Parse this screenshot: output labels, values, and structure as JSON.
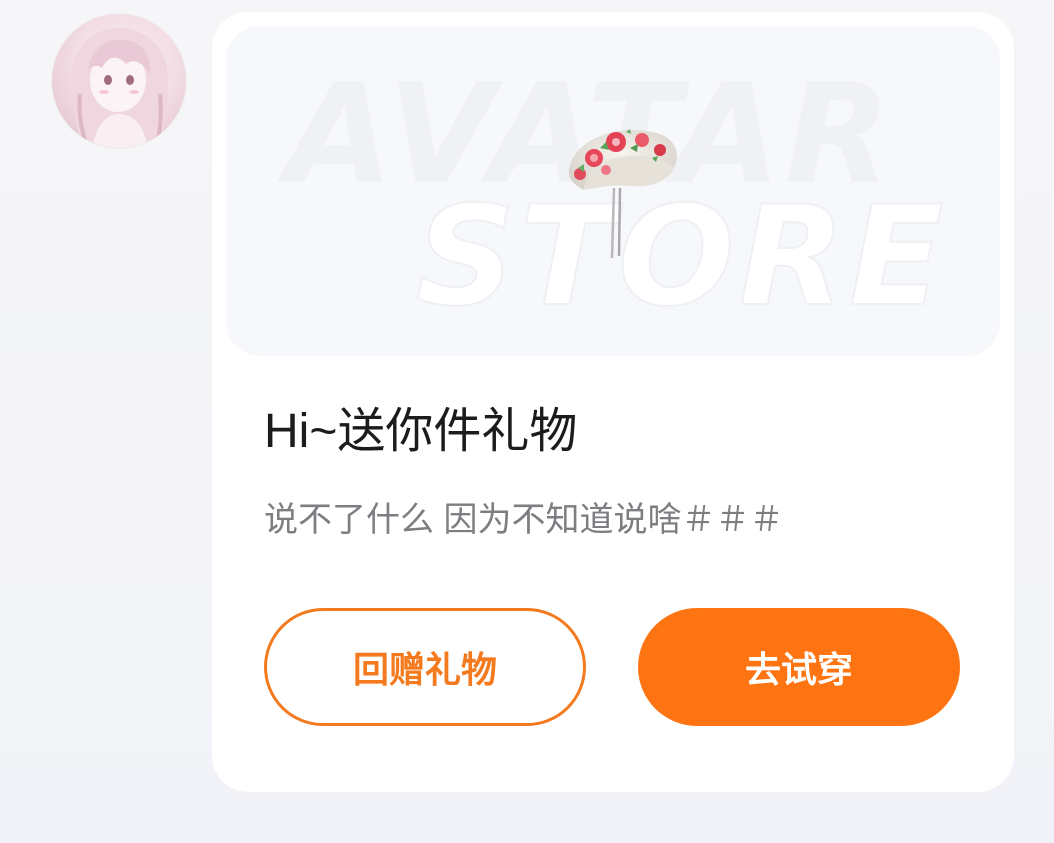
{
  "colors": {
    "accent": "#ff7412",
    "accent_outline": "#f47a1f",
    "title": "#1c1c1e",
    "subtitle": "#7d7d82",
    "card": "#ffffff",
    "page": "#f4f5f9"
  },
  "sender": {
    "avatar_icon": "anime-girl-avatar"
  },
  "gift_card": {
    "banner": {
      "watermark_line1": "AVATAR",
      "watermark_line2": "STORE",
      "product_icon": "floral-hair-clip-icon"
    },
    "title": "Hi~送你件礼物",
    "message": "说不了什么 因为不知道说啥＃＃＃",
    "buttons": {
      "return_gift": "回赠礼物",
      "try_on": "去试穿"
    }
  }
}
